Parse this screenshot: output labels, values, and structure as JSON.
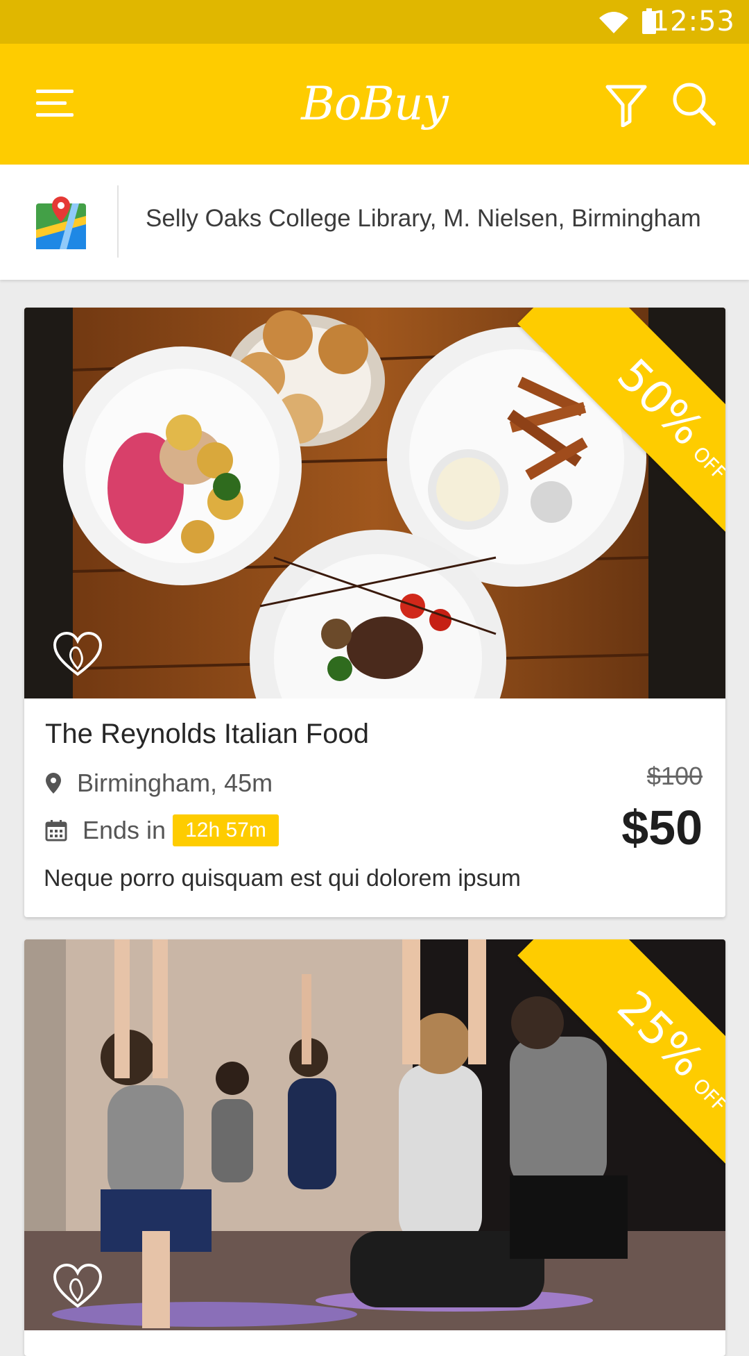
{
  "status_bar": {
    "time": "12:53",
    "icons": [
      "wifi-icon",
      "battery-icon"
    ]
  },
  "app_bar": {
    "title": "BoBuy",
    "icons": [
      "menu-icon",
      "filter-icon",
      "search-icon"
    ],
    "accent_color": "#fecc00"
  },
  "location": {
    "icon": "map-icon",
    "text": "Selly Oaks College Library, M. Nielsen, Birmingham"
  },
  "deals": [
    {
      "image": "food-photo",
      "discount": "50%",
      "discount_suffix": "OFF",
      "title": "The Reynolds Italian Food",
      "location": "Birmingham, 45m",
      "ends_label": "Ends in",
      "timer": "12h 57m",
      "old_price": "$100",
      "new_price": "$50",
      "description": "Neque porro quisquam est qui dolorem ipsum"
    },
    {
      "image": "yoga-photo",
      "discount": "25%",
      "discount_suffix": "OFF"
    }
  ]
}
